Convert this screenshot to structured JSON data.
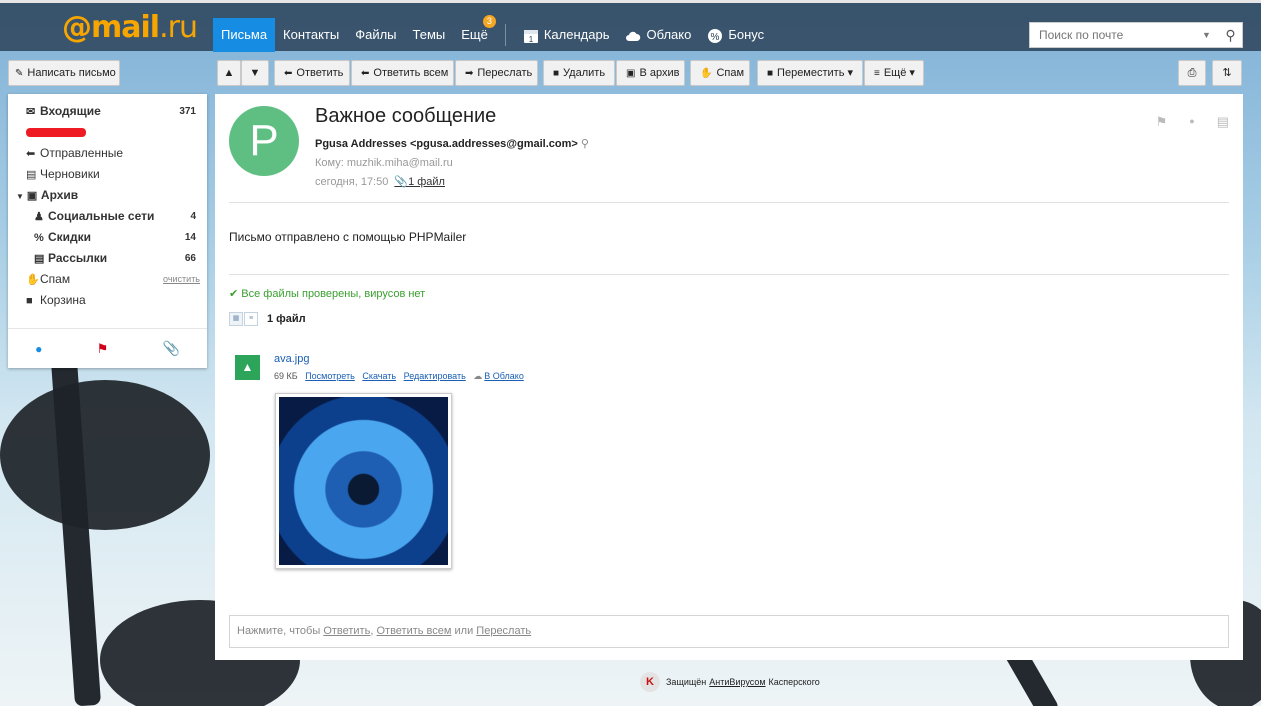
{
  "logo": {
    "at": "@mail",
    "ru": ".ru"
  },
  "nav": {
    "items": [
      "Письма",
      "Контакты",
      "Файлы",
      "Темы",
      "Ещё"
    ],
    "more_badge": "3",
    "calendar": "Календарь",
    "cloud": "Облако",
    "bonus": "Бонус"
  },
  "search": {
    "placeholder": "Поиск по почте"
  },
  "compose_label": "Написать письмо",
  "toolbar": {
    "reply": "Ответить",
    "reply_all": "Ответить всем",
    "forward": "Переслать",
    "delete": "Удалить",
    "archive": "В архив",
    "spam": "Спам",
    "move": "Переместить",
    "more": "Ещё"
  },
  "sidebar": {
    "inbox": {
      "label": "Входящие",
      "count": "371"
    },
    "sent": "Отправленные",
    "drafts": "Черновики",
    "archive": "Архив",
    "social": {
      "label": "Социальные сети",
      "count": "4"
    },
    "discounts": {
      "label": "Скидки",
      "count": "14"
    },
    "newsletters": {
      "label": "Рассылки",
      "count": "66"
    },
    "spam": {
      "label": "Спам",
      "action": "очистить"
    },
    "trash": "Корзина"
  },
  "message": {
    "avatar_letter": "P",
    "subject": "Важное сообщение",
    "from": "Pgusa Addresses <pgusa.addresses@gmail.com>",
    "to": "Кому: muzhik.miha@mail.ru",
    "date": "сегодня, 17:50",
    "attach_link": "1 файл",
    "body": "Письмо отправлено с помощью PHPMailer",
    "virus_check": "Все файлы проверены, вирусов нет",
    "files_title": "1 файл",
    "file": {
      "name": "ava.jpg",
      "size": "69 КБ",
      "view": "Посмотреть",
      "download": "Скачать",
      "edit": "Редактировать",
      "to_cloud": "В Облако"
    }
  },
  "reply_box": {
    "prefix": "Нажмите, чтобы",
    "reply": "Ответить",
    "reply_all": "Ответить всем",
    "or": "или",
    "forward": "Переслать"
  },
  "footer": {
    "protected": "Защищён",
    "antivirus": "АнтиВирусом",
    "kaspersky": "Касперского"
  },
  "colors": {
    "accent": "#168de2",
    "topbar": "#283e54",
    "badge": "#f5a623",
    "avatar": "#5fbf83"
  }
}
